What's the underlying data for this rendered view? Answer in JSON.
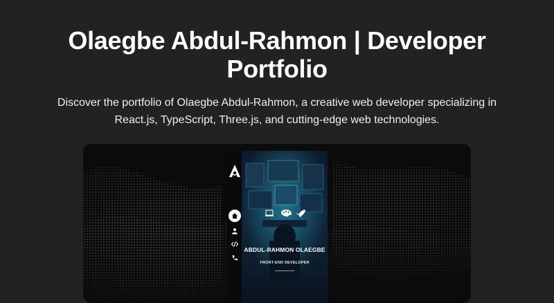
{
  "page": {
    "title": "Olaegbe Abdul-Rahmon | Developer Portfolio",
    "description": "Discover the portfolio of Olaegbe Abdul-Rahmon, a creative web developer specializing in React.js, TypeScript, Three.js, and cutting-edge web technologies."
  },
  "preview": {
    "sidebar": {
      "logo": "logo-a-icon",
      "items": [
        {
          "icon": "home-icon",
          "active": true
        },
        {
          "icon": "user-icon",
          "active": false
        },
        {
          "icon": "code-icon",
          "active": false
        },
        {
          "icon": "phone-icon",
          "active": false
        }
      ]
    },
    "hero": {
      "name": "ABDUL-RAHMON OLAEGBE",
      "role": "FRONT-END DEVELOPER",
      "icons": [
        "laptop-icon",
        "palette-icon",
        "rocket-icon"
      ]
    }
  },
  "colors": {
    "background": "#222223",
    "preview_bg": "#0b0b0b",
    "panel_bg": "#0b1626",
    "accent_teal": "#1fb3c7"
  }
}
